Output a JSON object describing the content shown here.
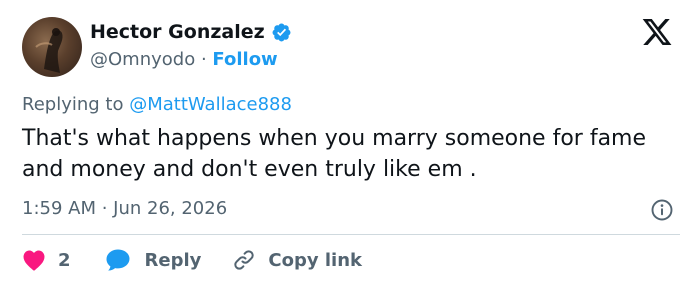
{
  "author": {
    "name": "Hector Gonzalez",
    "handle": "@Omnyodo",
    "separator": "·",
    "follow_label": "Follow"
  },
  "reply_context": {
    "prefix": "Replying to",
    "mention": "@MattWallace888"
  },
  "tweet": {
    "text": "That's what happens when you marry someone for fame and money and don't even truly like em .",
    "timestamp": "1:59 AM · Jun 26, 2026"
  },
  "actions": {
    "like_count": "2",
    "reply_label": "Reply",
    "copy_link_label": "Copy link"
  },
  "icons": {
    "verified": "verified-badge-icon",
    "x_logo": "x-logo-icon",
    "info": "info-icon",
    "like": "heart-icon",
    "reply": "speech-bubble-icon",
    "copy_link": "link-icon"
  },
  "colors": {
    "accent": "#1d9bf0",
    "like": "#f91880",
    "text": "#0f1419",
    "secondary": "#536471"
  }
}
